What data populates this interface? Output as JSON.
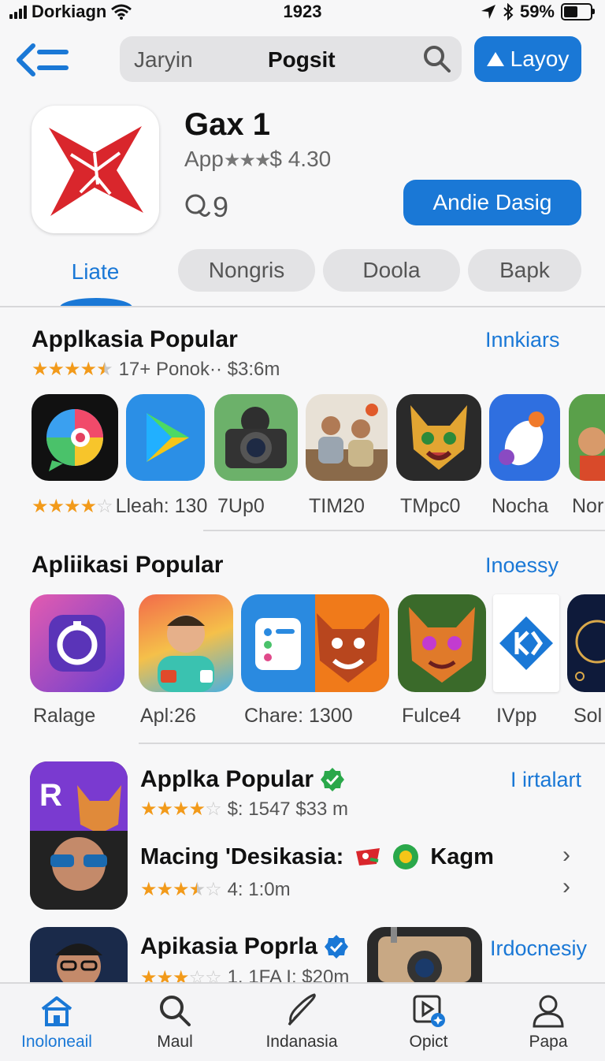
{
  "status": {
    "carrier": "Dorkiagn",
    "time": "1923",
    "battery": "59%",
    "battery_level": 0.59
  },
  "header": {
    "search_placeholder": "Jaryin",
    "search_query": "Pogsit",
    "layout_button": "Layoy"
  },
  "app": {
    "name": "Gax 1",
    "meta_prefix": "App",
    "meta_stars": "★★★",
    "price": "$ 4.30",
    "info": "Q9",
    "get_button": "Andie Dasig"
  },
  "tabs": [
    {
      "label": "Liate",
      "active": true
    },
    {
      "label": "Nongris"
    },
    {
      "label": "Doola"
    },
    {
      "label": "Bapk"
    }
  ],
  "section1": {
    "title": "Applkasia Popular",
    "link": "Innkiars",
    "rating_text": "17+ Ponok·· $3:6m",
    "rating": 4.5,
    "item_rating": 4,
    "captions": [
      "Lleah: 130",
      "7Up0",
      "TIM20",
      "TMpc0",
      "Nocha",
      "Norr"
    ],
    "icons": [
      "chat-app-icon",
      "play-store-icon",
      "camera-app-icon",
      "photo-app-icon",
      "fox-game-icon",
      "mouse-app-icon",
      "kid-game-icon"
    ]
  },
  "section2": {
    "title": "Apliikasi Popular",
    "link": "Inoessy",
    "captions": [
      "Ralage",
      "Apl:26",
      "Chare:",
      "1300",
      "Fulce4",
      "IVpp",
      "Sol"
    ],
    "icons": [
      "timer-app-icon",
      "boy-avatar-icon",
      "notes-app-icon",
      "bear-game-icon",
      "cat-game-icon",
      "kx-app-icon",
      "space-app-icon"
    ]
  },
  "section3": {
    "title": "Applka Popular",
    "link": "I irtalart",
    "rating_text": "$:  1547 $33 m",
    "rating": 4,
    "row2_title": "Macing 'Desikasia:",
    "row2_app": "Kagm",
    "row2_rating_text": "4:  1:0m",
    "row2_rating": 3.5,
    "chevron": "›"
  },
  "section4": {
    "title": "Apikasia Poprla",
    "link": "Irdocnesiy",
    "rating_text": "1.  1FA  I: $20m",
    "rating": 3
  },
  "nav": [
    {
      "label": "Inoloneail",
      "icon": "home-icon",
      "active": true
    },
    {
      "label": "Maul",
      "icon": "search-icon"
    },
    {
      "label": "Indanasia",
      "icon": "feather-icon"
    },
    {
      "label": "Opict",
      "icon": "media-icon"
    },
    {
      "label": "Papa",
      "icon": "person-icon"
    }
  ],
  "colors": {
    "accent": "#1a78d6",
    "star": "#f29a1a",
    "verified": "#2aa84a"
  }
}
